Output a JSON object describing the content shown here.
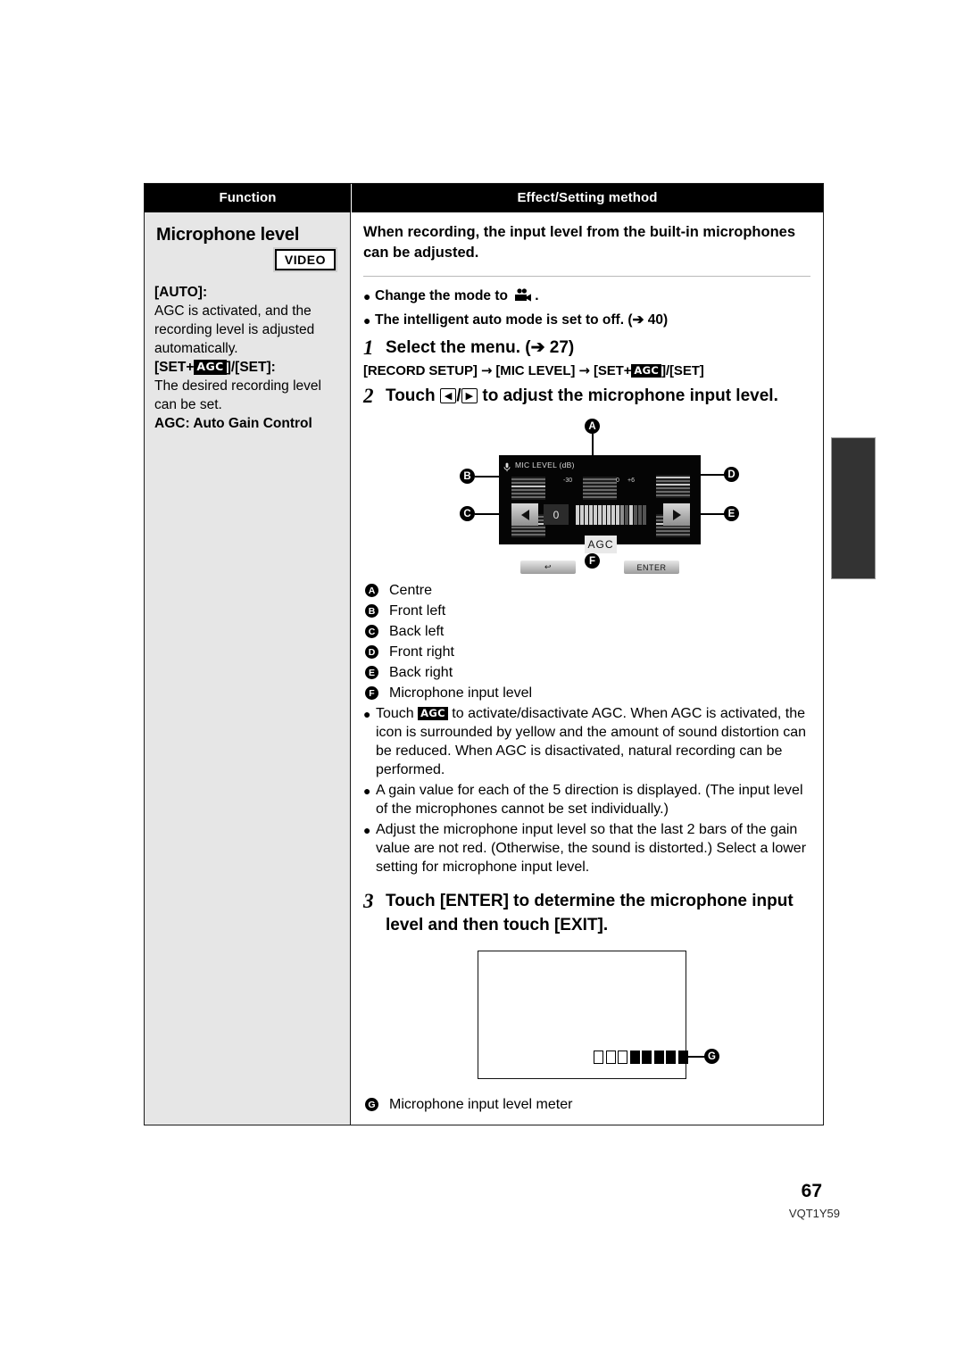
{
  "table": {
    "headers": {
      "function": "Function",
      "effect": "Effect/Setting method"
    },
    "function_cell": {
      "title": "Microphone level",
      "badge": "VIDEO",
      "auto_label": "[AUTO]:",
      "auto_text": "AGC is activated, and the recording level is adjusted automatically.",
      "set_label_pre": "[SET",
      "set_label_plus": "+",
      "set_badge": "AGC",
      "set_label_post": "]/[SET]:",
      "set_text": "The desired recording level can be set.",
      "agc_expansion": "AGC: Auto Gain Control"
    },
    "effect_cell": {
      "intro": "When recording, the input level from the built-in microphones can be adjusted.",
      "bullets_top": [
        {
          "text_before": "Change the mode to",
          "icon": "camcorder-icon",
          "text_after": "."
        },
        {
          "text_before": "The intelligent auto mode is set to off. (➔ 40)",
          "icon": "",
          "text_after": ""
        }
      ],
      "steps": [
        {
          "num": "1",
          "text": "Select the menu. (➔ 27)"
        },
        {
          "num": "2",
          "text_parts": [
            "Touch",
            "/",
            "to adjust the microphone input level."
          ]
        },
        {
          "num": "3",
          "text": "Touch [ENTER] to determine the microphone input level and then touch [EXIT]."
        }
      ],
      "menu_path": {
        "p1": "[RECORD SETUP]",
        "arrow1": "→",
        "p2": "[MIC LEVEL]",
        "arrow2": "→",
        "p3_pre": "[SET",
        "p3_plus": "+",
        "p3_badge": "AGC",
        "p3_post": "]/[SET]"
      },
      "legend": [
        {
          "key": "A",
          "label": "Centre"
        },
        {
          "key": "B",
          "label": "Front left"
        },
        {
          "key": "C",
          "label": "Back left"
        },
        {
          "key": "D",
          "label": "Front right"
        },
        {
          "key": "E",
          "label": "Back right"
        },
        {
          "key": "F",
          "label": "Microphone input level"
        }
      ],
      "notes": [
        {
          "pre": "Touch",
          "badge": "AGC",
          "post": "to activate/disactivate AGC. When AGC is activated, the icon is surrounded by yellow and the amount of sound distortion can be reduced. When AGC is disactivated, natural recording can be performed."
        },
        {
          "pre": "",
          "badge": "",
          "post": "A gain value for each of the 5 direction is displayed. (The input level of the microphones cannot be set individually.)"
        },
        {
          "pre": "",
          "badge": "",
          "post": "Adjust the microphone input level so that the last 2 bars of the gain value are not red. (Otherwise, the sound is distorted.) Select a lower setting for microphone input level."
        }
      ],
      "legend_g": {
        "key": "G",
        "label": "Microphone input level meter"
      }
    }
  },
  "lcd_screen": {
    "title": "MIC LEVEL (dB)",
    "value": "0",
    "scale": {
      "min": "-30",
      "mid": "0",
      "max": "+6"
    },
    "agc_button": "AGC",
    "back_button": "↩",
    "enter_button": "ENTER",
    "left_arrow": "left-arrow",
    "right_arrow": "right-arrow",
    "callouts": [
      "A",
      "B",
      "C",
      "D",
      "E",
      "F"
    ]
  },
  "level_meter": {
    "empty_blocks": 3,
    "filled_blocks": 5,
    "callout": "G"
  },
  "footer": {
    "page_number": "67",
    "doc_code": "VQT1Y59"
  },
  "colors": {
    "header_bg": "#000000",
    "function_col_bg": "#e6e6e6",
    "index_tab": "#333333",
    "lcd_bg": "#050505"
  }
}
